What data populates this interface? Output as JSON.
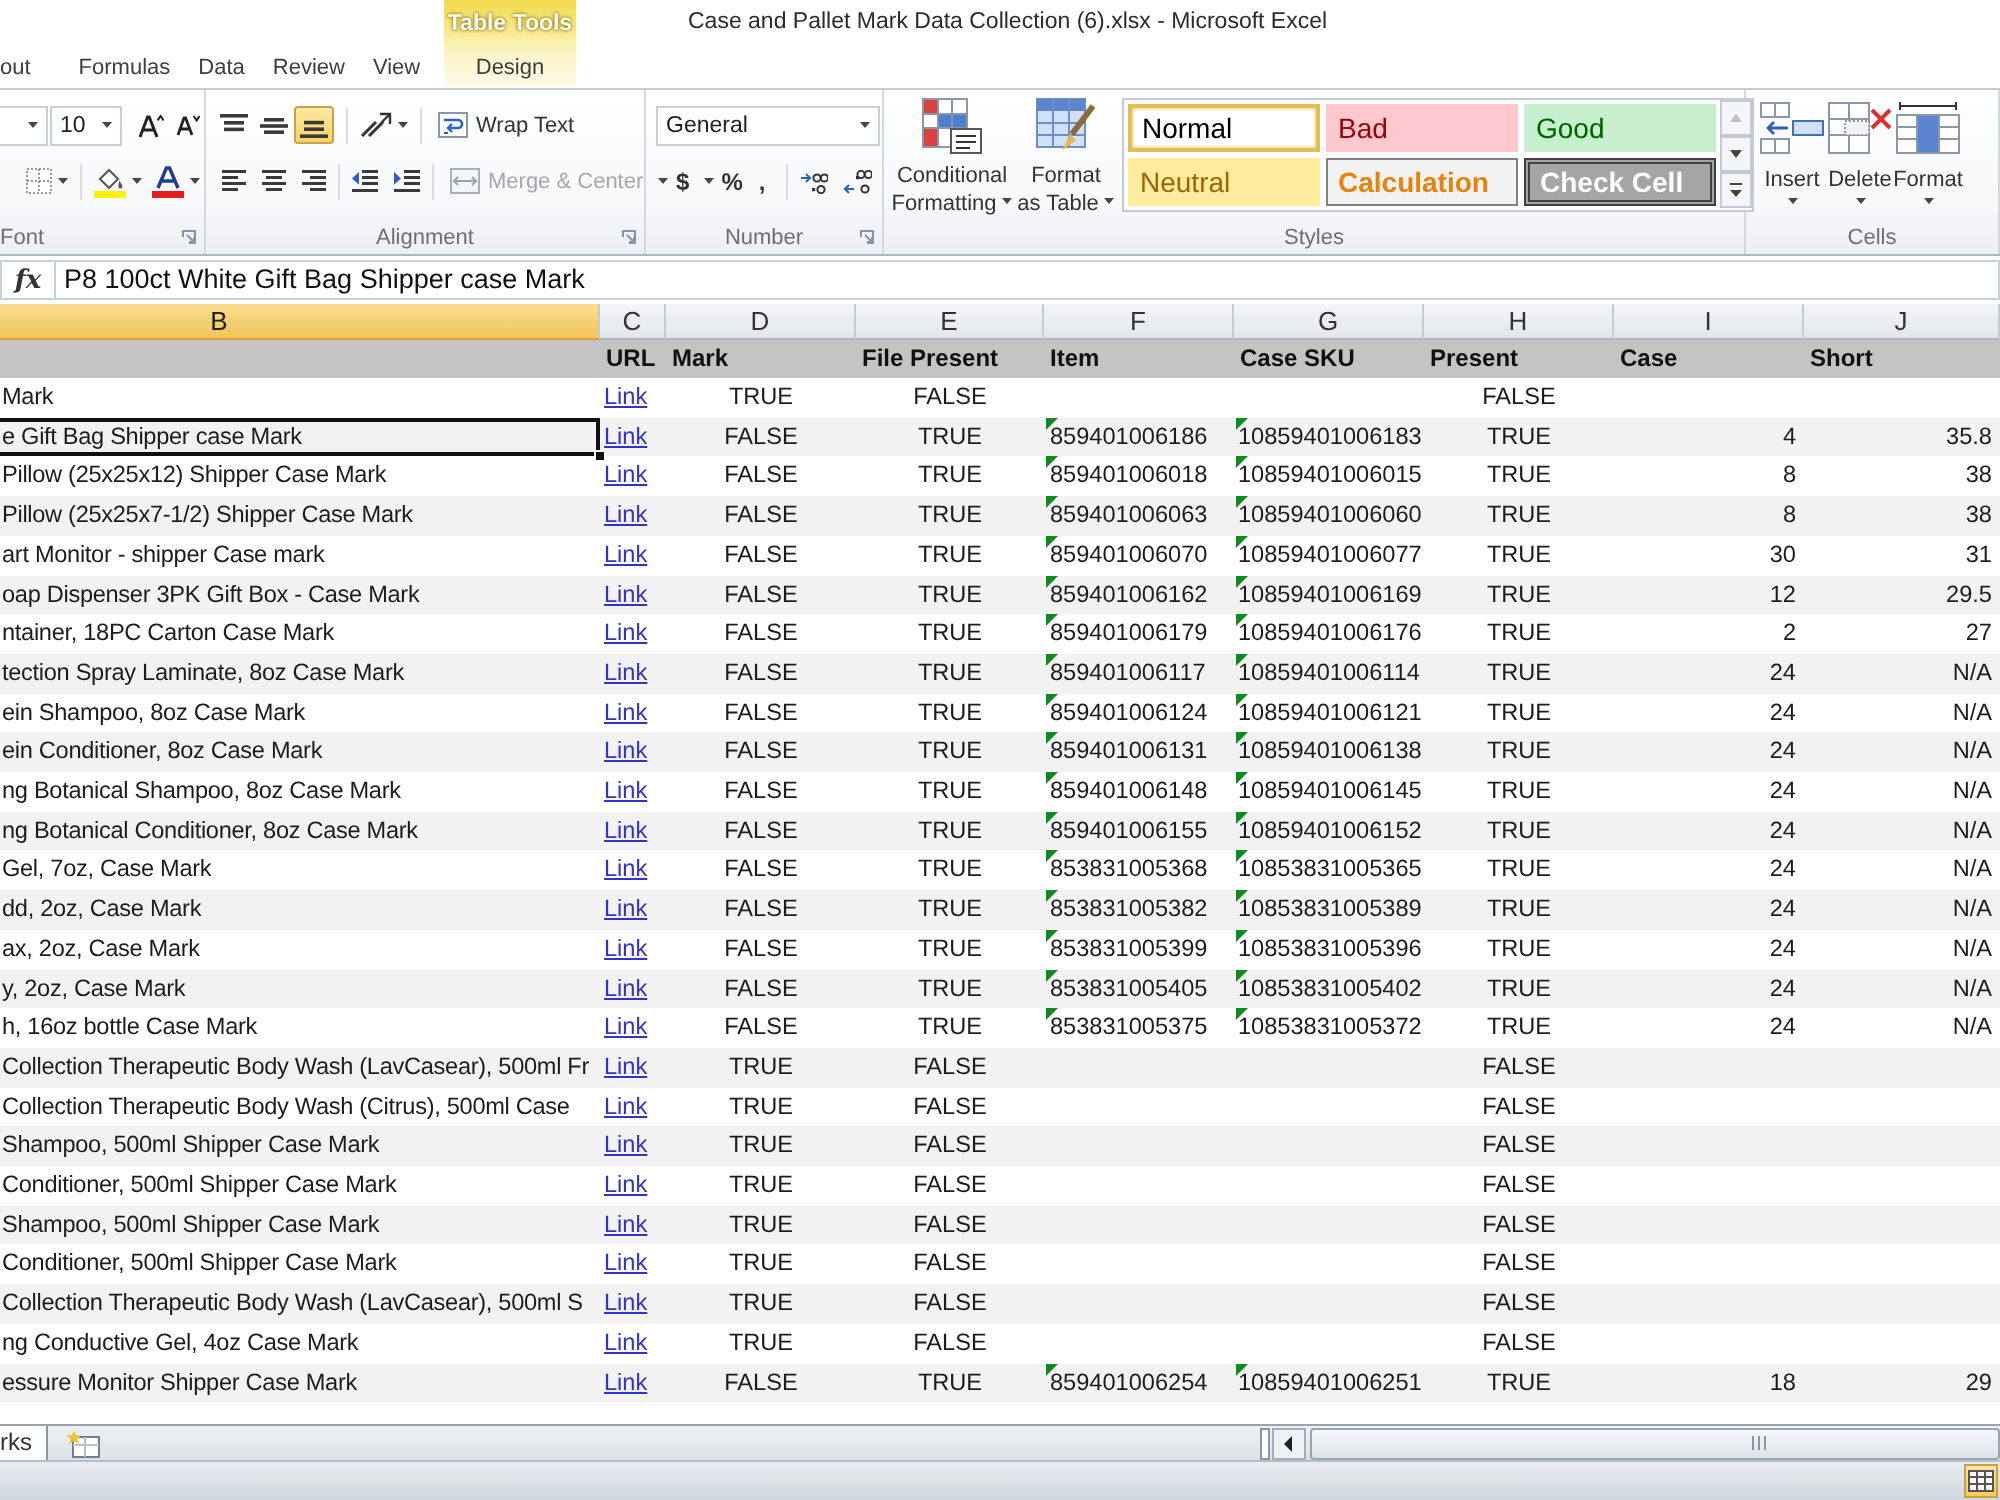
{
  "window": {
    "title": "Case and Pallet Mark Data Collection (6).xlsx - Microsoft Excel"
  },
  "ribbon": {
    "contextual_group": "Table Tools",
    "tabs": [
      {
        "label": "out",
        "kind": "standard",
        "selected": false
      },
      {
        "label": "Formulas",
        "kind": "standard",
        "selected": false
      },
      {
        "label": "Data",
        "kind": "standard",
        "selected": false
      },
      {
        "label": "Review",
        "kind": "standard",
        "selected": false
      },
      {
        "label": "View",
        "kind": "standard",
        "selected": false
      },
      {
        "label": "Design",
        "kind": "contextual",
        "selected": false
      }
    ],
    "font": {
      "label": "Font",
      "size": "10"
    },
    "alignment": {
      "label": "Alignment",
      "vertical": [
        {
          "kind": "top",
          "selected": false
        },
        {
          "kind": "middle",
          "selected": false
        },
        {
          "kind": "bottom",
          "selected": true
        }
      ],
      "wrap_text": {
        "label": "Wrap Text",
        "disabled": false
      },
      "merge": {
        "label": "Merge & Center",
        "disabled": true
      }
    },
    "number": {
      "label": "Number",
      "format": "General",
      "symbols": [
        {
          "kind": "currency",
          "symbol": "$"
        },
        {
          "kind": "percent",
          "symbol": "%"
        },
        {
          "kind": "comma",
          "symbol": ","
        }
      ]
    },
    "styles": {
      "label": "Styles",
      "commands": [
        {
          "kind": "conditional",
          "label": "Conditional Formatting"
        },
        {
          "kind": "table",
          "label": "Format as Table"
        }
      ],
      "gallery": [
        {
          "label": "Normal",
          "kind": "normal",
          "selected": true
        },
        {
          "label": "Bad",
          "kind": "bad",
          "selected": false
        },
        {
          "label": "Good",
          "kind": "good",
          "selected": false
        },
        {
          "label": "Neutral",
          "kind": "neutral",
          "selected": false
        },
        {
          "label": "Calculation",
          "kind": "calculation",
          "selected": false
        },
        {
          "label": "Check Cell",
          "kind": "check",
          "selected": false
        }
      ]
    },
    "cells": {
      "label": "Cells",
      "commands": [
        {
          "kind": "insert",
          "label": "Insert"
        },
        {
          "kind": "delete",
          "label": "Delete"
        },
        {
          "kind": "format",
          "label": "Format"
        }
      ]
    }
  },
  "formula_bar": {
    "function_button": "fx",
    "content": "P8 100ct White Gift Bag Shipper case Mark"
  },
  "sheet": {
    "columns": [
      {
        "letter": "B",
        "selected": true
      },
      {
        "letter": "C",
        "heading": "URL",
        "selected": false
      },
      {
        "letter": "D",
        "heading": "Mark",
        "selected": false
      },
      {
        "letter": "E",
        "heading": "File Present",
        "selected": false
      },
      {
        "letter": "F",
        "heading": "Item",
        "selected": false
      },
      {
        "letter": "G",
        "heading": "Case SKU",
        "selected": false
      },
      {
        "letter": "H",
        "heading": "Present",
        "selected": false
      },
      {
        "letter": "I",
        "heading": "Case",
        "selected": false
      },
      {
        "letter": "J",
        "heading": "Short",
        "selected": false
      }
    ],
    "rows": [
      {
        "column_b": "Mark",
        "url": "Link",
        "mark": "TRUE",
        "file_present": "FALSE",
        "present": "FALSE",
        "flagged": false,
        "selected": false
      },
      {
        "column_b": "e Gift Bag Shipper case Mark",
        "url": "Link",
        "mark": "FALSE",
        "file_present": "TRUE",
        "item": "859401006186",
        "case_sku": "10859401006183",
        "present": "TRUE",
        "case": "4",
        "short": "35.8",
        "flagged": true,
        "selected": true
      },
      {
        "column_b": "Pillow (25x25x12) Shipper Case Mark",
        "url": "Link",
        "mark": "FALSE",
        "file_present": "TRUE",
        "item": "859401006018",
        "case_sku": "10859401006015",
        "present": "TRUE",
        "case": "8",
        "short": "38",
        "flagged": true,
        "selected": false
      },
      {
        "column_b": "Pillow (25x25x7-1/2) Shipper Case Mark",
        "url": "Link",
        "mark": "FALSE",
        "file_present": "TRUE",
        "item": "859401006063",
        "case_sku": "10859401006060",
        "present": "TRUE",
        "case": "8",
        "short": "38",
        "flagged": true,
        "selected": false
      },
      {
        "column_b": "art Monitor - shipper Case mark",
        "url": "Link",
        "mark": "FALSE",
        "file_present": "TRUE",
        "item": "859401006070",
        "case_sku": "10859401006077",
        "present": "TRUE",
        "case": "30",
        "short": "31",
        "flagged": true,
        "selected": false
      },
      {
        "column_b": "oap Dispenser 3PK Gift Box - Case Mark",
        "url": "Link",
        "mark": "FALSE",
        "file_present": "TRUE",
        "item": "859401006162",
        "case_sku": "10859401006169",
        "present": "TRUE",
        "case": "12",
        "short": "29.5",
        "flagged": true,
        "selected": false
      },
      {
        "column_b": "ntainer, 18PC Carton Case Mark",
        "url": "Link",
        "mark": "FALSE",
        "file_present": "TRUE",
        "item": "859401006179",
        "case_sku": "10859401006176",
        "present": "TRUE",
        "case": "2",
        "short": "27",
        "flagged": true,
        "selected": false
      },
      {
        "column_b": "tection Spray Laminate, 8oz Case Mark",
        "url": "Link",
        "mark": "FALSE",
        "file_present": "TRUE",
        "item": "859401006117",
        "case_sku": "10859401006114",
        "present": "TRUE",
        "case": "24",
        "short": "N/A",
        "flagged": true,
        "selected": false
      },
      {
        "column_b": "ein Shampoo, 8oz Case Mark",
        "url": "Link",
        "mark": "FALSE",
        "file_present": "TRUE",
        "item": "859401006124",
        "case_sku": "10859401006121",
        "present": "TRUE",
        "case": "24",
        "short": "N/A",
        "flagged": true,
        "selected": false
      },
      {
        "column_b": "ein Conditioner, 8oz Case Mark",
        "url": "Link",
        "mark": "FALSE",
        "file_present": "TRUE",
        "item": "859401006131",
        "case_sku": "10859401006138",
        "present": "TRUE",
        "case": "24",
        "short": "N/A",
        "flagged": true,
        "selected": false
      },
      {
        "column_b": "ng Botanical Shampoo, 8oz Case Mark",
        "url": "Link",
        "mark": "FALSE",
        "file_present": "TRUE",
        "item": "859401006148",
        "case_sku": "10859401006145",
        "present": "TRUE",
        "case": "24",
        "short": "N/A",
        "flagged": true,
        "selected": false
      },
      {
        "column_b": "ng Botanical Conditioner, 8oz Case Mark",
        "url": "Link",
        "mark": "FALSE",
        "file_present": "TRUE",
        "item": "859401006155",
        "case_sku": "10859401006152",
        "present": "TRUE",
        "case": "24",
        "short": "N/A",
        "flagged": true,
        "selected": false
      },
      {
        "column_b": "Gel, 7oz, Case Mark",
        "url": "Link",
        "mark": "FALSE",
        "file_present": "TRUE",
        "item": "853831005368",
        "case_sku": "10853831005365",
        "present": "TRUE",
        "case": "24",
        "short": "N/A",
        "flagged": true,
        "selected": false
      },
      {
        "column_b": "dd, 2oz, Case Mark",
        "url": "Link",
        "mark": "FALSE",
        "file_present": "TRUE",
        "item": "853831005382",
        "case_sku": "10853831005389",
        "present": "TRUE",
        "case": "24",
        "short": "N/A",
        "flagged": true,
        "selected": false
      },
      {
        "column_b": "ax, 2oz, Case Mark",
        "url": "Link",
        "mark": "FALSE",
        "file_present": "TRUE",
        "item": "853831005399",
        "case_sku": "10853831005396",
        "present": "TRUE",
        "case": "24",
        "short": "N/A",
        "flagged": true,
        "selected": false
      },
      {
        "column_b": "y, 2oz, Case Mark",
        "url": "Link",
        "mark": "FALSE",
        "file_present": "TRUE",
        "item": "853831005405",
        "case_sku": "10853831005402",
        "present": "TRUE",
        "case": "24",
        "short": "N/A",
        "flagged": true,
        "selected": false
      },
      {
        "column_b": "h, 16oz bottle Case Mark",
        "url": "Link",
        "mark": "FALSE",
        "file_present": "TRUE",
        "item": "853831005375",
        "case_sku": "10853831005372",
        "present": "TRUE",
        "case": "24",
        "short": "N/A",
        "flagged": true,
        "selected": false
      },
      {
        "column_b": "Collection Therapeutic Body Wash (LavCasear), 500ml Fr",
        "url": "Link",
        "mark": "TRUE",
        "file_present": "FALSE",
        "present": "FALSE",
        "flagged": false,
        "selected": false
      },
      {
        "column_b": "Collection Therapeutic Body Wash (Citrus), 500ml Case",
        "url": "Link",
        "mark": "TRUE",
        "file_present": "FALSE",
        "present": "FALSE",
        "flagged": false,
        "selected": false
      },
      {
        "column_b": "Shampoo, 500ml Shipper Case Mark",
        "url": "Link",
        "mark": "TRUE",
        "file_present": "FALSE",
        "present": "FALSE",
        "flagged": false,
        "selected": false
      },
      {
        "column_b": "Conditioner, 500ml Shipper Case Mark",
        "url": "Link",
        "mark": "TRUE",
        "file_present": "FALSE",
        "present": "FALSE",
        "flagged": false,
        "selected": false
      },
      {
        "column_b": "Shampoo, 500ml Shipper Case Mark",
        "url": "Link",
        "mark": "TRUE",
        "file_present": "FALSE",
        "present": "FALSE",
        "flagged": false,
        "selected": false
      },
      {
        "column_b": "Conditioner, 500ml Shipper Case Mark",
        "url": "Link",
        "mark": "TRUE",
        "file_present": "FALSE",
        "present": "FALSE",
        "flagged": false,
        "selected": false
      },
      {
        "column_b": "Collection Therapeutic Body Wash (LavCasear), 500ml S",
        "url": "Link",
        "mark": "TRUE",
        "file_present": "FALSE",
        "present": "FALSE",
        "flagged": false,
        "selected": false
      },
      {
        "column_b": "ng Conductive Gel, 4oz Case Mark",
        "url": "Link",
        "mark": "TRUE",
        "file_present": "FALSE",
        "present": "FALSE",
        "flagged": false,
        "selected": false
      },
      {
        "column_b": "essure Monitor Shipper Case Mark",
        "url": "Link",
        "mark": "FALSE",
        "file_present": "TRUE",
        "item": "859401006254",
        "case_sku": "10859401006251",
        "present": "TRUE",
        "case": "18",
        "short": "29",
        "flagged": true,
        "selected": false
      }
    ]
  },
  "sheet_tabs": [
    {
      "label": "rks",
      "selected": true
    }
  ],
  "status_bar": {
    "view_buttons": [
      {
        "kind": "normal",
        "selected": true
      }
    ]
  }
}
